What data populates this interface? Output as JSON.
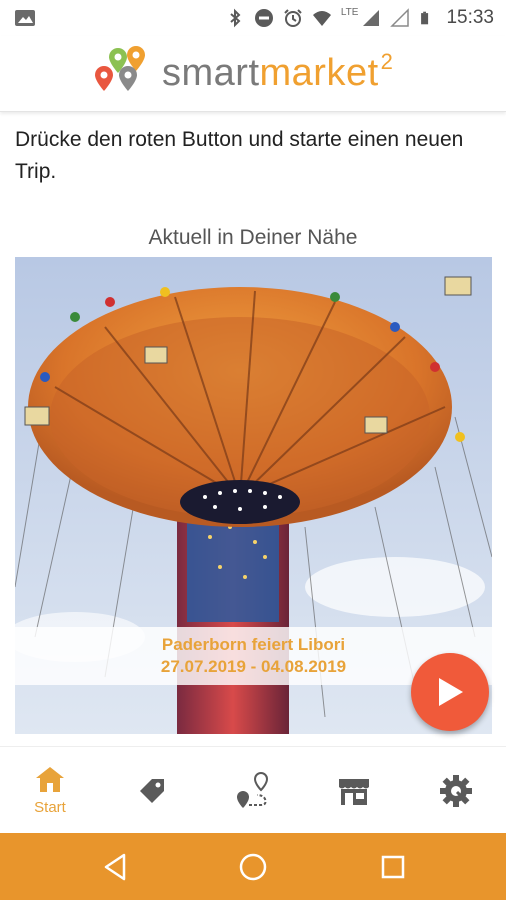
{
  "status_bar": {
    "time": "15:33",
    "network_label": "LTE",
    "icons": [
      "image-icon",
      "bluetooth-icon",
      "do-not-disturb-icon",
      "alarm-icon",
      "wifi-icon",
      "signal-icon",
      "signal-icon",
      "battery-icon"
    ]
  },
  "app_bar": {
    "logo_text_smart": "smart",
    "logo_text_market": "market",
    "logo_superscript": "2"
  },
  "main": {
    "intro_text": "Drücke den roten Button und starte einen neuen Trip.",
    "section_title": "Aktuell in Deiner Nähe",
    "event": {
      "title": "Paderborn feiert Libori",
      "dates": "27.07.2019 - 04.08.2019"
    }
  },
  "bottom_nav": {
    "items": [
      {
        "label": "Start",
        "icon": "home-icon",
        "active": true
      },
      {
        "label": "",
        "icon": "tag-icon",
        "active": false
      },
      {
        "label": "",
        "icon": "route-icon",
        "active": false
      },
      {
        "label": "",
        "icon": "store-icon",
        "active": false
      },
      {
        "label": "",
        "icon": "settings-icon",
        "active": false
      }
    ]
  },
  "colors": {
    "accent": "#e8a33a",
    "fab": "#f05a3a",
    "system_nav": "#e8952c",
    "icon_inactive": "#5a5a5a"
  }
}
